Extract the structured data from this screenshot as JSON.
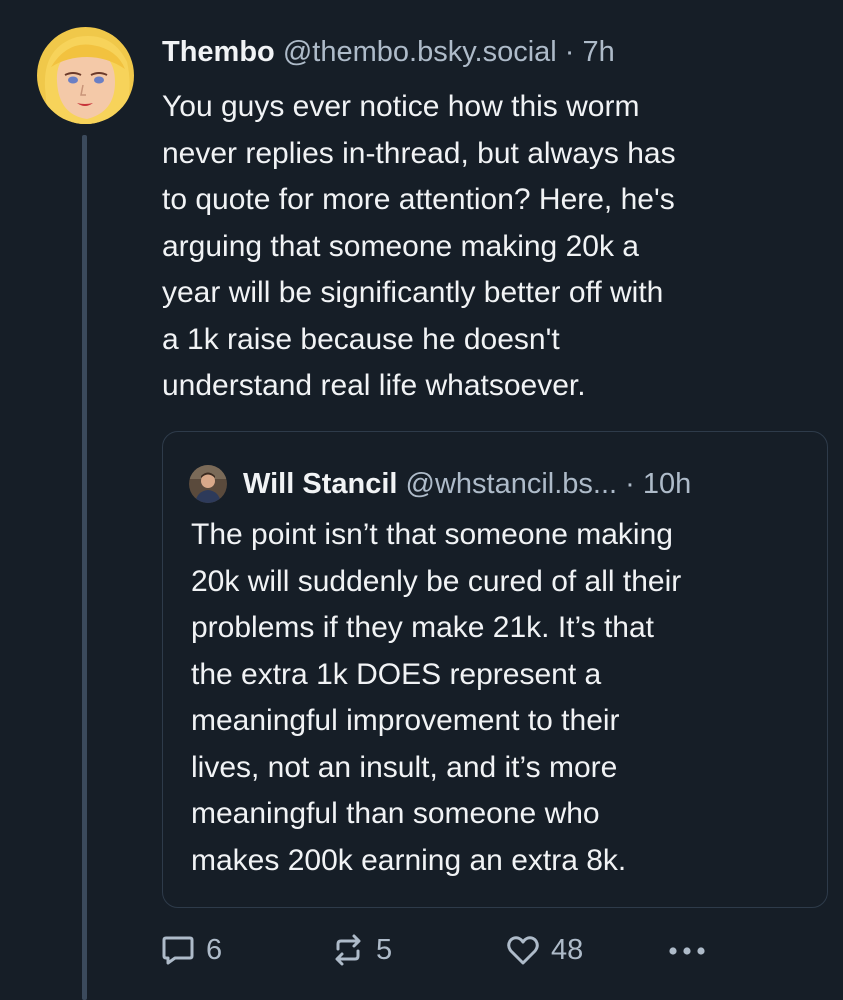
{
  "post": {
    "author": {
      "display_name": "Thembo",
      "handle": "@thembo.bsky.social",
      "separator": " · ",
      "time": "7h"
    },
    "text": "You guys ever notice how this worm\nnever replies in-thread, but always has\nto quote for more attention? Here, he's\narguing that someone making 20k a\nyear will be significantly better off with\na 1k raise because he doesn't\nunderstand real life whatsoever.",
    "quote": {
      "author": {
        "display_name": "Will Stancil",
        "handle": "@whstancil.bs...",
        "separator": "  · ",
        "time": "10h"
      },
      "text": "The point isn’t that someone making\n20k will suddenly be cured of all their\nproblems if they make 21k. It’s that\nthe extra 1k DOES represent a\nmeaningful improvement to their\nlives, not an insult, and it’s more\nmeaningful than someone who\nmakes 200k earning an extra 8k."
    },
    "actions": {
      "reply_count": "6",
      "repost_count": "5",
      "like_count": "48"
    }
  },
  "icons": {
    "reply": "speech-bubble-icon",
    "repost": "repost-arrows-icon",
    "like": "heart-outline-icon",
    "more": "ellipsis-icon"
  },
  "colors": {
    "background": "#161e27",
    "text_primary": "#f1f3f5",
    "text_secondary": "#aebbc9",
    "thread_line": "#3b4a5c",
    "quote_border": "#2e3b4a"
  }
}
